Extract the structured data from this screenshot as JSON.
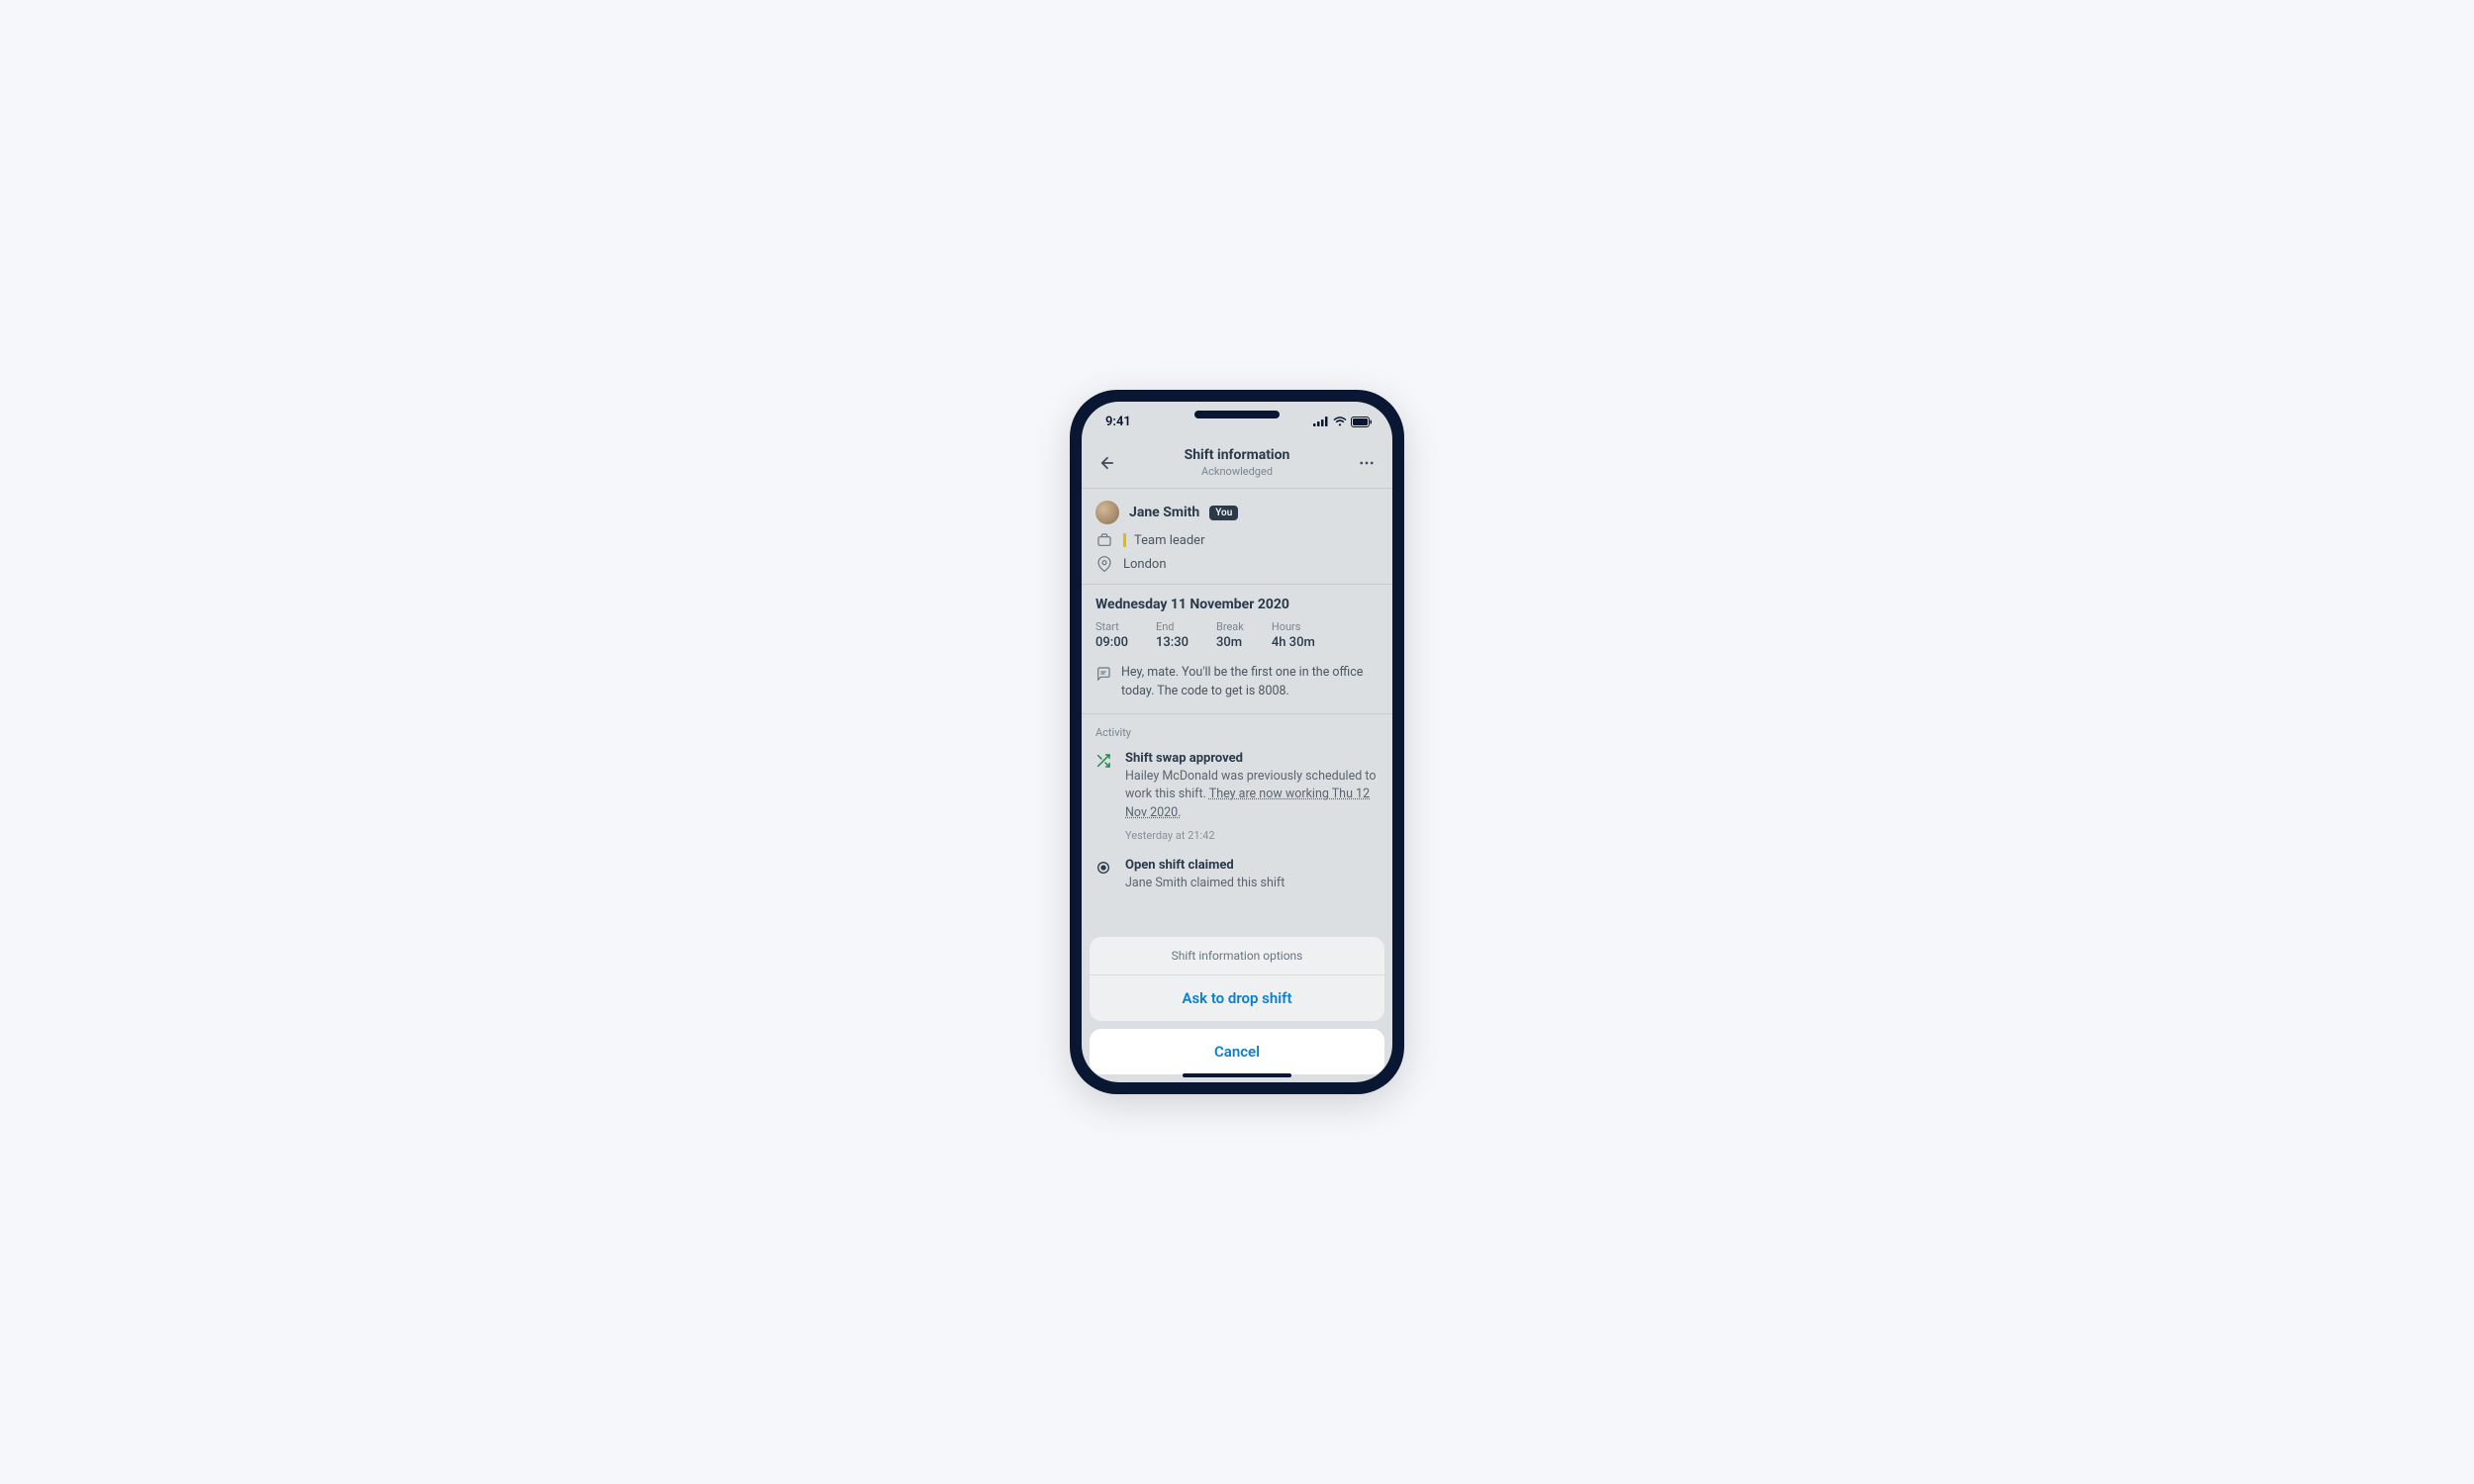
{
  "status_bar": {
    "time": "9:41"
  },
  "header": {
    "title": "Shift information",
    "subtitle": "Acknowledged"
  },
  "user": {
    "name": "Jane Smith",
    "you_label": "You",
    "role": "Team leader",
    "location": "London"
  },
  "shift": {
    "date": "Wednesday 11 November 2020",
    "cols": [
      {
        "label": "Start",
        "value": "09:00"
      },
      {
        "label": "End",
        "value": "13:30"
      },
      {
        "label": "Break",
        "value": "30m"
      },
      {
        "label": "Hours",
        "value": "4h 30m"
      }
    ],
    "note": "Hey, mate. You'll be the first one in the office today. The code to get is 8008."
  },
  "activity": {
    "label": "Activity",
    "items": [
      {
        "title": "Shift swap approved",
        "desc_pre": "Hailey McDonald was previously scheduled to work this shift. ",
        "desc_link": "They are now working Thu 12 Nov 2020.",
        "time": "Yesterday at 21:42"
      },
      {
        "title": "Open shift claimed",
        "desc": "Jane Smith claimed this shift"
      }
    ]
  },
  "sheet": {
    "header": "Shift information options",
    "option": "Ask to drop shift",
    "cancel": "Cancel"
  }
}
